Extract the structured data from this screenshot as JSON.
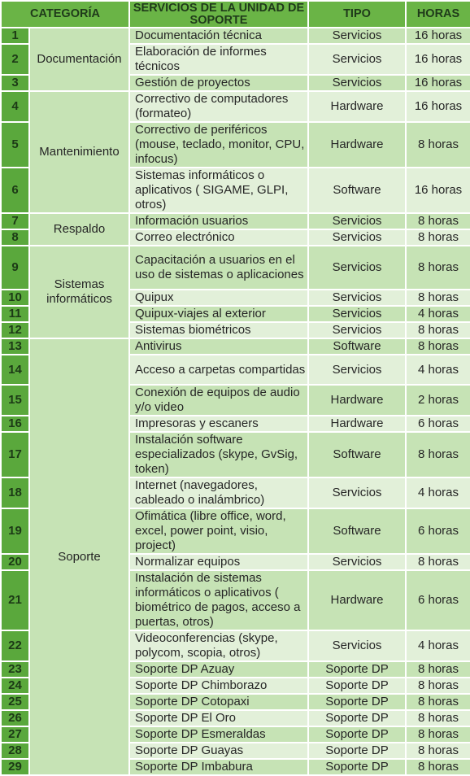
{
  "headers": {
    "categoria": "CATEGORÍA",
    "servicios": "SERVICIOS DE LA UNIDAD DE SOPORTE",
    "tipo": "TIPO",
    "horas": "HORAS"
  },
  "colors": {
    "header_bg": "#6ab446",
    "number_bg": "#5aa83c",
    "row_dark": "#c6e3b5",
    "row_light": "#e2f0d9"
  },
  "categories": [
    {
      "name": "Documentación",
      "span": 3
    },
    {
      "name": "Mantenimiento",
      "span": 3
    },
    {
      "name": "Respaldo",
      "span": 2
    },
    {
      "name": "Sistemas informáticos",
      "span": 4
    },
    {
      "name": "Soporte",
      "span": 17
    }
  ],
  "rows": [
    {
      "num": "1",
      "servicio": "Documentación técnica",
      "tipo": "Servicios",
      "horas": "16 horas"
    },
    {
      "num": "2",
      "servicio": "Elaboración de informes técnicos",
      "tipo": "Servicios",
      "horas": "16 horas"
    },
    {
      "num": "3",
      "servicio": "Gestión de proyectos",
      "tipo": "Servicios",
      "horas": "16 horas"
    },
    {
      "num": "4",
      "servicio": "Correctivo de computadores (formateo)",
      "tipo": "Hardware",
      "horas": "16 horas"
    },
    {
      "num": "5",
      "servicio": "Correctivo de periféricos (mouse, teclado, monitor, CPU, infocus)",
      "tipo": "Hardware",
      "horas": "8 horas"
    },
    {
      "num": "6",
      "servicio": "Sistemas informáticos o aplicativos ( SIGAME, GLPI, otros)",
      "tipo": "Software",
      "horas": "16 horas"
    },
    {
      "num": "7",
      "servicio": "Información usuarios",
      "tipo": "Servicios",
      "horas": "8 horas"
    },
    {
      "num": "8",
      "servicio": "Correo electrónico",
      "tipo": "Servicios",
      "horas": "8 horas"
    },
    {
      "num": "9",
      "servicio": "Capacitación a usuarios en el uso de sistemas o aplicaciones",
      "tipo": "Servicios",
      "horas": "8 horas"
    },
    {
      "num": "10",
      "servicio": "Quipux",
      "tipo": "Servicios",
      "horas": "8 horas"
    },
    {
      "num": "11",
      "servicio": "Quipux-viajes al exterior",
      "tipo": "Servicios",
      "horas": "4 horas"
    },
    {
      "num": "12",
      "servicio": "Sistemas biométricos",
      "tipo": "Servicios",
      "horas": "8 horas"
    },
    {
      "num": "13",
      "servicio": "Antivirus",
      "tipo": "Software",
      "horas": "8 horas"
    },
    {
      "num": "14",
      "servicio": "Acceso a carpetas compartidas",
      "tipo": "Servicios",
      "horas": "4 horas"
    },
    {
      "num": "15",
      "servicio": "Conexión de equipos de audio y/o video",
      "tipo": "Hardware",
      "horas": "2 horas"
    },
    {
      "num": "16",
      "servicio": "Impresoras y escaners",
      "tipo": "Hardware",
      "horas": "6 horas"
    },
    {
      "num": "17",
      "servicio": "Instalación software especializados (skype, GvSig, token)",
      "tipo": "Software",
      "horas": "8 horas"
    },
    {
      "num": "18",
      "servicio": "Internet (navegadores, cableado o inalámbrico)",
      "tipo": "Servicios",
      "horas": "4 horas"
    },
    {
      "num": "19",
      "servicio": "Ofimática (libre office, word, excel, power point, visio, project)",
      "tipo": "Software",
      "horas": "6 horas"
    },
    {
      "num": "20",
      "servicio": "Normalizar equipos",
      "tipo": "Servicios",
      "horas": "8 horas"
    },
    {
      "num": "21",
      "servicio": "Instalación de sistemas informáticos o aplicativos ( biométrico de pagos, acceso a puertas, otros)",
      "tipo": "Hardware",
      "horas": "6 horas"
    },
    {
      "num": "22",
      "servicio": "Videoconferencias (skype, polycom, scopia, otros)",
      "tipo": "Servicios",
      "horas": "4 horas"
    },
    {
      "num": "23",
      "servicio": "Soporte DP Azuay",
      "tipo": "Soporte DP",
      "horas": "8 horas"
    },
    {
      "num": "24",
      "servicio": "Soporte DP Chimborazo",
      "tipo": "Soporte DP",
      "horas": "8 horas"
    },
    {
      "num": "25",
      "servicio": "Soporte DP Cotopaxi",
      "tipo": "Soporte DP",
      "horas": "8 horas"
    },
    {
      "num": "26",
      "servicio": "Soporte DP El Oro",
      "tipo": "Soporte DP",
      "horas": "8 horas"
    },
    {
      "num": "27",
      "servicio": "Soporte DP Esmeraldas",
      "tipo": "Soporte DP",
      "horas": "8 horas"
    },
    {
      "num": "28",
      "servicio": "Soporte DP Guayas",
      "tipo": "Soporte DP",
      "horas": "8 horas"
    },
    {
      "num": "29",
      "servicio": "Soporte DP Imbabura",
      "tipo": "Soporte DP",
      "horas": "8 horas"
    }
  ]
}
